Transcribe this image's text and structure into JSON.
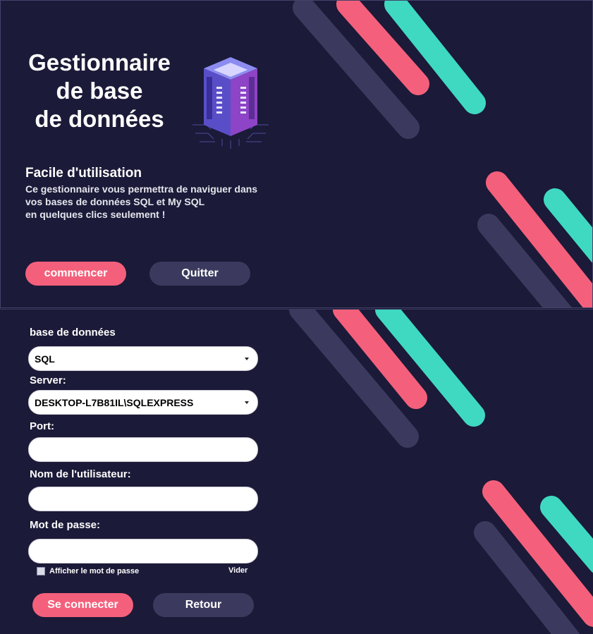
{
  "colors": {
    "background": "#1b1a38",
    "accent_pink": "#f4607b",
    "accent_teal": "#3fd9c2",
    "stripe_muted": "#3b3a5e"
  },
  "welcome": {
    "title_lines": [
      "Gestionnaire",
      "de base",
      "de données"
    ],
    "graphic_icon": "database-server-icon",
    "subtitle": "Facile d'utilisation",
    "description_lines": [
      "Ce gestionnaire vous permettra de naviguer dans",
      "vos bases de données SQL et My SQL",
      "en quelques clics seulement !"
    ],
    "start_label": "commencer",
    "quit_label": "Quitter"
  },
  "login": {
    "db_label": "base de données",
    "db_value": "SQL",
    "server_label": "Server:",
    "server_value": "DESKTOP-L7B81IL\\SQLEXPRESS",
    "port_label": "Port:",
    "port_value": "",
    "user_label": "Nom de l'utilisateur:",
    "user_value": "",
    "password_label": "Mot de passe:",
    "password_value": "",
    "show_password_label": "Afficher le mot de passe",
    "show_password_checked": false,
    "clear_label": "Vider",
    "connect_label": "Se connecter",
    "back_label": "Retour"
  }
}
